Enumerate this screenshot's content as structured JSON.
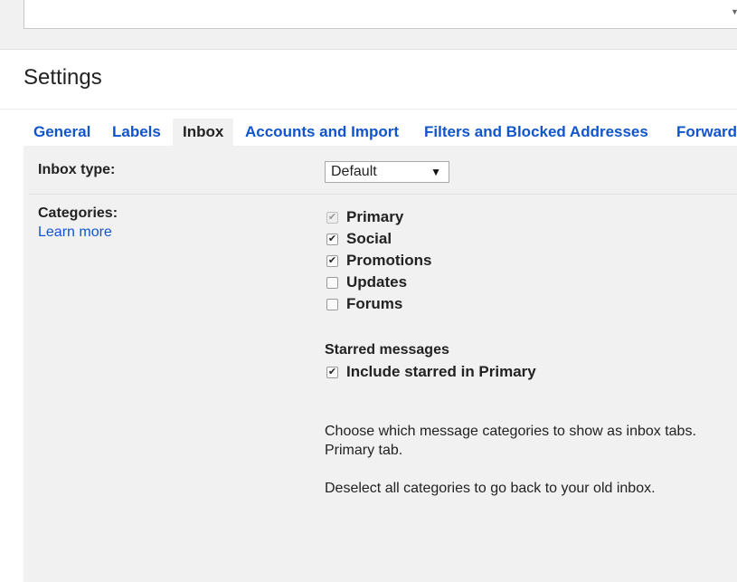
{
  "header": {
    "title": "Settings"
  },
  "tabs": [
    {
      "label": "General"
    },
    {
      "label": "Labels"
    },
    {
      "label": "Inbox",
      "active": true
    },
    {
      "label": "Accounts and Import"
    },
    {
      "label": "Filters and Blocked Addresses"
    },
    {
      "label": "Forward"
    }
  ],
  "inbox_type": {
    "label": "Inbox type:",
    "selected": "Default"
  },
  "categories": {
    "label": "Categories:",
    "learn_more": "Learn more",
    "items": [
      {
        "label": "Primary",
        "checked": true,
        "disabled": true
      },
      {
        "label": "Social",
        "checked": true,
        "disabled": false
      },
      {
        "label": "Promotions",
        "checked": true,
        "disabled": false
      },
      {
        "label": "Updates",
        "checked": false,
        "disabled": false
      },
      {
        "label": "Forums",
        "checked": false,
        "disabled": false
      }
    ],
    "starred": {
      "heading": "Starred messages",
      "option": "Include starred in Primary",
      "checked": true
    },
    "help_line1": "Choose which message categories to show as inbox tabs.",
    "help_line2": "Primary tab.",
    "help_line3": "Deselect all categories to go back to your old inbox."
  },
  "icons": {
    "check": "✔",
    "dropdown": "▼"
  }
}
